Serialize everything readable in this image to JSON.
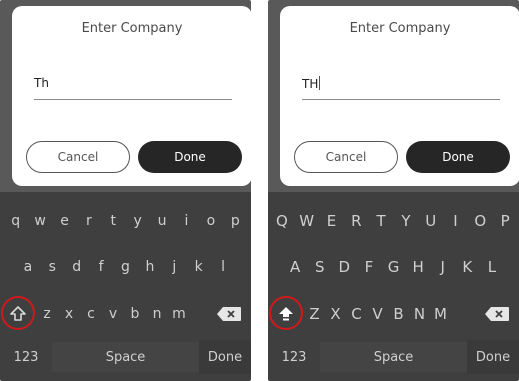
{
  "screens": [
    {
      "dialog": {
        "title": "Enter Company",
        "input_value": "Th",
        "cancel_label": "Cancel",
        "done_label": "Done"
      },
      "keyboard": {
        "row1": [
          "q",
          "w",
          "e",
          "r",
          "t",
          "y",
          "u",
          "i",
          "o",
          "p"
        ],
        "row2": [
          "a",
          "s",
          "d",
          "f",
          "g",
          "h",
          "j",
          "k",
          "l"
        ],
        "row3": [
          "z",
          "x",
          "c",
          "v",
          "b",
          "n",
          "m"
        ],
        "numbers_label": "123",
        "space_label": "Space",
        "done_label": "Done",
        "shift_state": "off"
      }
    },
    {
      "dialog": {
        "title": "Enter Company",
        "input_value": "TH",
        "cancel_label": "Cancel",
        "done_label": "Done"
      },
      "keyboard": {
        "row1": [
          "Q",
          "W",
          "E",
          "R",
          "T",
          "Y",
          "U",
          "I",
          "O",
          "P"
        ],
        "row2": [
          "A",
          "S",
          "D",
          "F",
          "G",
          "H",
          "J",
          "K",
          "L"
        ],
        "row3": [
          "Z",
          "X",
          "C",
          "V",
          "B",
          "N",
          "M"
        ],
        "numbers_label": "123",
        "space_label": "Space",
        "done_label": "Done",
        "shift_state": "on"
      }
    }
  ],
  "colors": {
    "highlight_ring": "#d0191c",
    "keyboard_bg": "#3f3f3f",
    "dim_bg": "#595959",
    "done_button_bg": "#262626"
  },
  "icons": {
    "shift_off": "shift-outline-icon",
    "shift_on": "shift-filled-icon",
    "backspace": "backspace-icon"
  }
}
